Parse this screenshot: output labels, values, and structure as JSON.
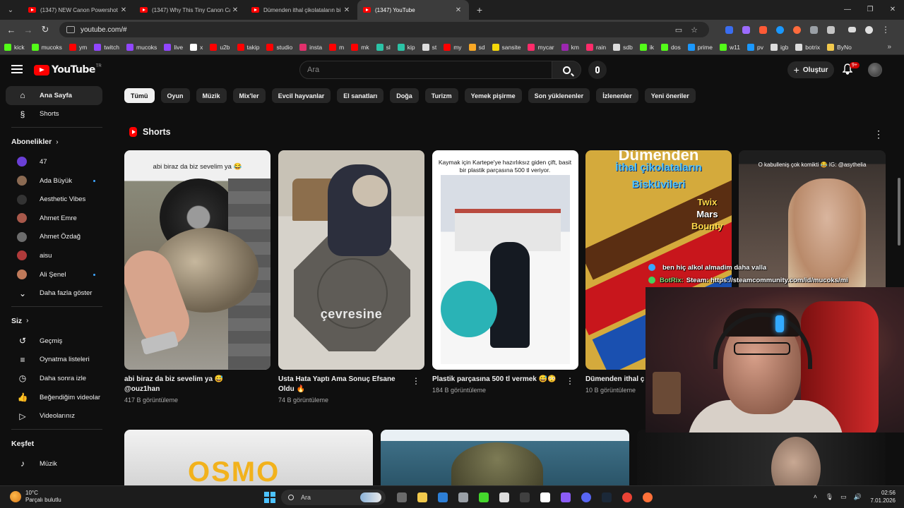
{
  "browser": {
    "tabs": [
      {
        "title": "(1347) NEW Canon Powershot V1",
        "active": false
      },
      {
        "title": "(1347) Why This Tiny Canon Ca",
        "active": false
      },
      {
        "title": "Dümenden ithal çikolataların bi",
        "active": false
      },
      {
        "title": "(1347) YouTube",
        "active": true
      }
    ],
    "url": "youtube.com/#",
    "bookmarks": [
      "kick",
      "mucoks",
      "ym",
      "twitch",
      "mucoks",
      "live",
      "x",
      "u2b",
      "takip",
      "studio",
      "insta",
      "m",
      "mk",
      "sl",
      "kip",
      "st",
      "my",
      "sd",
      "sansite",
      "mycar",
      "km",
      "rain",
      "sdb",
      "ik",
      "dos",
      "prime",
      "w11",
      "pv",
      "igb",
      "botrix",
      "ByNo"
    ],
    "bookmark_colors": [
      "#53fc18",
      "#53fc18",
      "#ff0000",
      "#9146ff",
      "#9146ff",
      "#9146ff",
      "#ffffff",
      "#ff0000",
      "#ff0000",
      "#ff0000",
      "#e1306c",
      "#ff0000",
      "#ff0000",
      "#2bc3a6",
      "#2bc3a6",
      "#dddddd",
      "#ff0000",
      "#f9a825",
      "#f5d90a",
      "#ff2b6a",
      "#9c27b0",
      "#ff2b6a",
      "#dddddd",
      "#53fc18",
      "#53fc18",
      "#1a98ff",
      "#53fc18",
      "#1a98ff",
      "#dddddd",
      "#dddddd",
      "#f2c94c"
    ]
  },
  "youtube": {
    "logo": "YouTube",
    "logo_sup": "TR",
    "search_placeholder": "Ara",
    "create_label": "Oluştur",
    "notif_badge": "9+",
    "sidebar": {
      "main": [
        {
          "label": "Ana Sayfa",
          "icon": "home-icon",
          "active": true
        },
        {
          "label": "Shorts",
          "icon": "shorts-icon",
          "active": false
        }
      ],
      "subs_title": "Abonelikler",
      "subs": [
        {
          "label": "47",
          "color": "#6a3fd6",
          "dot": false
        },
        {
          "label": "Ada Büyük",
          "color": "#8b6a52",
          "dot": true
        },
        {
          "label": "Aesthetic Vibes",
          "color": "#333333",
          "dot": false
        },
        {
          "label": "Ahmet Emre",
          "color": "#a8584a",
          "dot": false
        },
        {
          "label": "Ahmet Özdağ",
          "color": "#6c6c6c",
          "dot": false
        },
        {
          "label": "aisu",
          "color": "#b03a3a",
          "dot": false
        },
        {
          "label": "Ali Şenel",
          "color": "#c07a5a",
          "dot": true
        }
      ],
      "show_more": "Daha fazla göster",
      "you_title": "Siz",
      "you": [
        {
          "label": "Geçmiş",
          "icon": "history-icon"
        },
        {
          "label": "Oynatma listeleri",
          "icon": "playlists-icon"
        },
        {
          "label": "Daha sonra izle",
          "icon": "watch-later-icon"
        },
        {
          "label": "Beğendiğim videolar",
          "icon": "liked-icon"
        },
        {
          "label": "Videolarınız",
          "icon": "your-videos-icon"
        }
      ],
      "explore_title": "Keşfet",
      "explore": [
        {
          "label": "Müzik",
          "icon": "music-icon"
        }
      ]
    },
    "chips": [
      "Tümü",
      "Oyun",
      "Müzik",
      "Mix'ler",
      "Evcil hayvanlar",
      "El sanatları",
      "Doğa",
      "Turizm",
      "Yemek pişirme",
      "Son yüklenenler",
      "İzlenenler",
      "Yeni öneriler"
    ],
    "shorts_title": "Shorts",
    "shorts": [
      {
        "title": "abi biraz da biz sevelim ya 😅 @ouz1han",
        "views": "417 B görüntüleme",
        "caption": "abi biraz da biz sevelim ya 😂"
      },
      {
        "title": "Usta Hata Yaptı Ama Sonuç Efsane Oldu 🔥",
        "views": "74 B görüntüleme",
        "caption": "çevresine"
      },
      {
        "title": "Plastik parçasına 500 tl vermek 😅😳",
        "views": "184 B görüntüleme",
        "caption": "Kaymak için Kartepe'ye hazırlıksız giden çift, basit bir plastik parçasına 500 tl veriyor."
      },
      {
        "title": "Dümenden ithal ç barları deniyiicez #",
        "views": "10 B görüntüleme",
        "caption": "Dümenden"
      }
    ],
    "short4_lines": [
      "İthal çikolataların",
      "Bisküvileri"
    ],
    "short4_bars": [
      "Twix",
      "Mars",
      "Bounty"
    ],
    "short5_caption": "O kabulleniş çok komikti 😂 IG: @asythelia",
    "bottom_overlay": "OSMO"
  },
  "stream_chat": [
    {
      "user": "",
      "text": "ben hiç alkol almadim daha valla"
    },
    {
      "user": "BotRix:",
      "text": "Steam: https://steamcommunity.com/id/mucoks/mi"
    }
  ],
  "taskbar": {
    "temp": "10°C",
    "weather": "Parçalı bulutlu",
    "search": "Ara",
    "time": "02:56",
    "date": "7.01.2026",
    "apps": [
      {
        "name": "task-view-app",
        "color": "#6b6b6b"
      },
      {
        "name": "file-explorer-app",
        "color": "#f2c94c"
      },
      {
        "name": "photos-app",
        "color": "#2d7fd6"
      },
      {
        "name": "settings-app",
        "color": "#9aa0a6"
      },
      {
        "name": "razer-app",
        "color": "#44d62c"
      },
      {
        "name": "github-app",
        "color": "#dddddd"
      },
      {
        "name": "app-dark",
        "color": "#404040"
      },
      {
        "name": "app-g",
        "color": "#ffffff"
      },
      {
        "name": "app-purple",
        "color": "#8b5cf6"
      },
      {
        "name": "discord-app",
        "color": "#5865f2"
      },
      {
        "name": "steam-app",
        "color": "#1b2838"
      },
      {
        "name": "chrome-app",
        "color": "#ea4335"
      },
      {
        "name": "firefox-app",
        "color": "#ff7139"
      }
    ]
  }
}
